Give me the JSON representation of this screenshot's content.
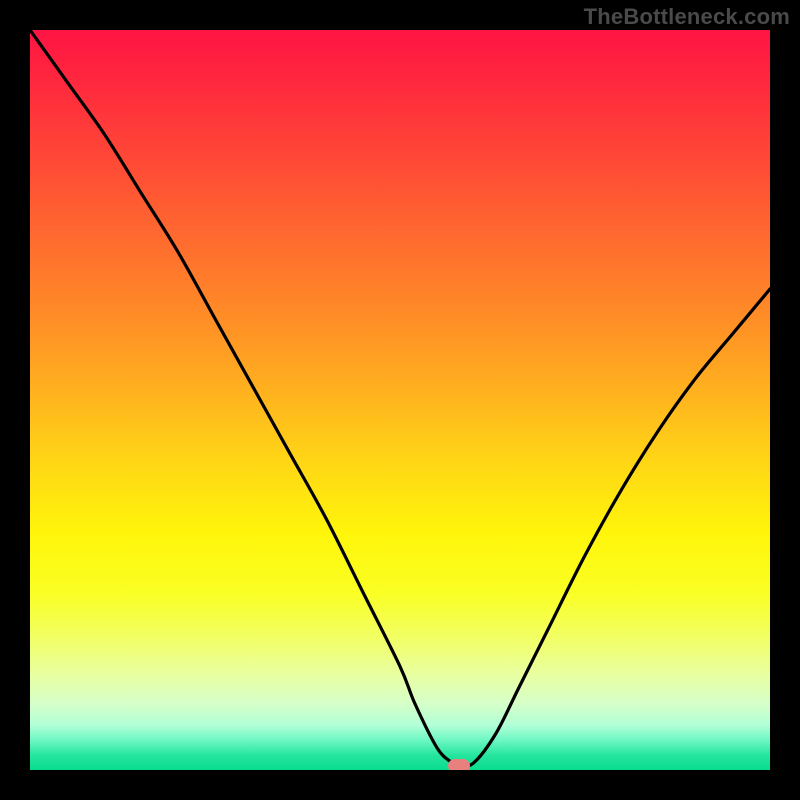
{
  "watermark": "TheBottleneck.com",
  "colors": {
    "frame": "#000000",
    "curve": "#000000",
    "marker": "#e8817e",
    "gradient_top": "#ff1443",
    "gradient_bottom": "#08dd8c"
  },
  "chart_data": {
    "type": "line",
    "title": "",
    "xlabel": "",
    "ylabel": "",
    "xlim": [
      0,
      100
    ],
    "ylim": [
      0,
      100
    ],
    "grid": false,
    "x": [
      0,
      5,
      10,
      15,
      20,
      25,
      30,
      35,
      40,
      45,
      50,
      52,
      55,
      57,
      58,
      60,
      63,
      66,
      70,
      75,
      80,
      85,
      90,
      95,
      100
    ],
    "y": [
      100,
      93,
      86,
      78,
      70,
      61,
      52,
      43,
      34,
      24,
      14,
      9,
      3,
      1,
      0.5,
      1,
      5,
      11,
      19,
      29,
      38,
      46,
      53,
      59,
      65
    ],
    "marker": {
      "x": 58,
      "y": 0.5
    },
    "note": "y encodes bottleneck percentage; background gradient sweeps red (high) to green (low)."
  }
}
